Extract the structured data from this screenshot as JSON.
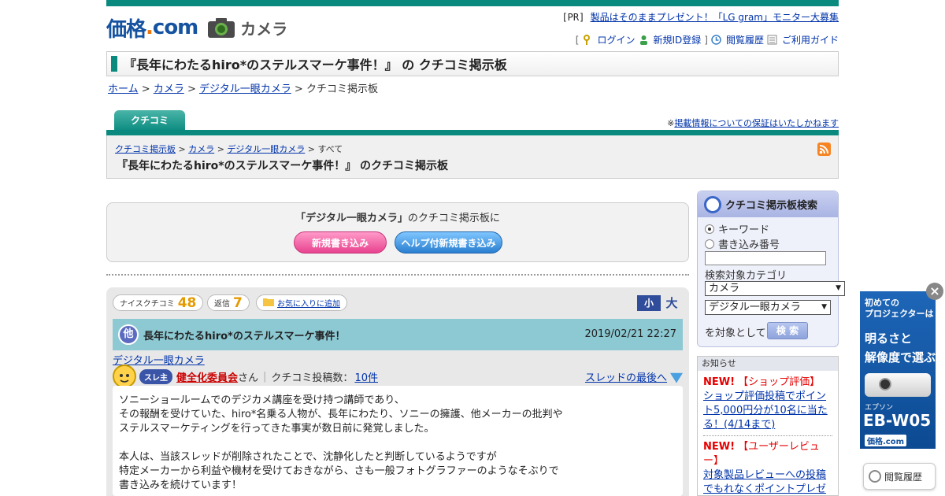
{
  "header": {
    "logo_kakaku": "価格",
    "logo_dot": ".",
    "logo_com": "com",
    "section": "カメラ",
    "pr_tag": "[PR]",
    "pr_link": "製品はそのままプレゼント！「LG gram」モニター大募集",
    "nav_open": "[",
    "nav_close": "]",
    "login": "ログイン",
    "register": "新規ID登録",
    "history": "閲覧履歴",
    "guide": "ご利用ガイド"
  },
  "page_title": "『長年にわたるhiro*のステルスマーケ事件！』 の クチコミ掲示板",
  "breadcrumb": {
    "home": "ホーム",
    "camera": "カメラ",
    "dslr": "デジタル一眼カメラ",
    "current": "クチコミ掲示板",
    "sep": ">"
  },
  "tab": {
    "label": "クチコミ"
  },
  "guarantee": {
    "mark": "※",
    "link": "掲載情報についての保証はいたしかねます"
  },
  "subhead": {
    "crumb_board": "クチコミ掲示板",
    "crumb_camera": "カメラ",
    "crumb_dslr": "デジタル一眼カメラ",
    "crumb_all": "すべて",
    "title": "『長年にわたるhiro*のステルスマーケ事件！』 のクチコミ掲示板",
    "rss_icon": "rss-icon"
  },
  "postbox": {
    "category": "「デジタル一眼カメラ」",
    "text": "のクチコミ掲示板に",
    "new_post": "新規書き込み",
    "help_post": "ヘルプ付新規書き込み"
  },
  "thread": {
    "nice_label": "ナイスクチコミ",
    "nice_count": "48",
    "reply_label": "返信",
    "reply_count": "7",
    "favorite": "お気に入りに追加",
    "size_small": "小",
    "size_large": "大",
    "badge": "他",
    "title": "長年にわたるhiro*のステルスマーケ事件！",
    "date": "2019/02/21 22:27",
    "category_link": "デジタル一眼カメラ",
    "starter_badge": "スレ主",
    "username": "健全化委員会",
    "san": "さん",
    "pipe": "|",
    "post_count_label": "クチコミ投稿数：",
    "post_count": "10件",
    "last_link": "スレッドの最後へ",
    "body": [
      "ソニーショールームでのデジカメ講座を受け持つ講師であり、",
      "その報酬を受けていた、hiro*名乗る人物が、長年にわたり、ソニーの擁護、他メーカーの批判や",
      "ステルスマーケティングを行ってきた事実が数日前に発覚しました。",
      "",
      "本人は、当該スレッドが削除されたことで、沈静化したと判断しているようですが",
      "特定メーカーから利益や機材を受けておきながら、さも一般フォトグラファーのようなそぶりで",
      "書き込みを続けています！"
    ]
  },
  "search": {
    "title": "クチコミ掲示板検索",
    "opt_keyword": "キーワード",
    "opt_number": "書き込み番号",
    "input_placeholder": "",
    "cat_label": "検索対象カテゴリ",
    "select1": "カメラ",
    "select2": "デジタル一眼カメラ",
    "target_text": "を対象として",
    "button": "検 索"
  },
  "notice": {
    "head": "お知らせ",
    "item1_new": "NEW!",
    "item1_tag": "【ショップ評価】",
    "item1_link": "ショップ評価投稿でポイント5,000円分が10名に当たる！(4/14まで)",
    "item2_new": "NEW!",
    "item2_tag": "【ユーザーレビュー】",
    "item2_link": "対象製品レビューへの投稿でもれなくポイントプレゼ"
  },
  "ad": {
    "line1a": "初めての",
    "line1b": "プロジェクターは",
    "line2a": "明るさと",
    "line2b": "解像度で選ぶ",
    "brand": "エプソン",
    "model": "EB-W05",
    "logo": "価格.com",
    "close": "×"
  },
  "history_float": {
    "label": "閲覧履歴"
  }
}
